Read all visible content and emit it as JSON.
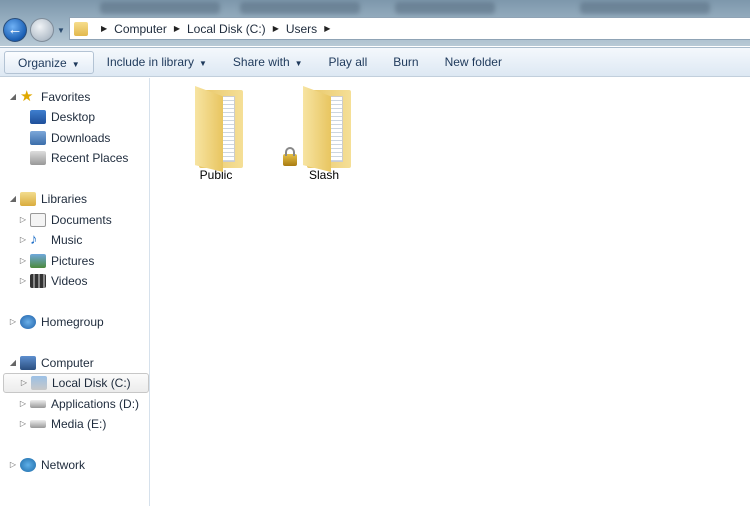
{
  "breadcrumb": [
    "Computer",
    "Local Disk (C:)",
    "Users"
  ],
  "toolbar": {
    "organize": "Organize",
    "include": "Include in library",
    "share": "Share with",
    "play": "Play all",
    "burn": "Burn",
    "new_folder": "New folder"
  },
  "sidebar": {
    "favorites": "Favorites",
    "desktop": "Desktop",
    "downloads": "Downloads",
    "recent": "Recent Places",
    "libraries": "Libraries",
    "documents": "Documents",
    "music": "Music",
    "pictures": "Pictures",
    "videos": "Videos",
    "homegroup": "Homegroup",
    "computer": "Computer",
    "c": "Local Disk (C:)",
    "d": "Applications (D:)",
    "e": "Media (E:)",
    "network": "Network"
  },
  "files": [
    {
      "name": "Public",
      "locked": false
    },
    {
      "name": "Slash",
      "locked": true
    }
  ]
}
